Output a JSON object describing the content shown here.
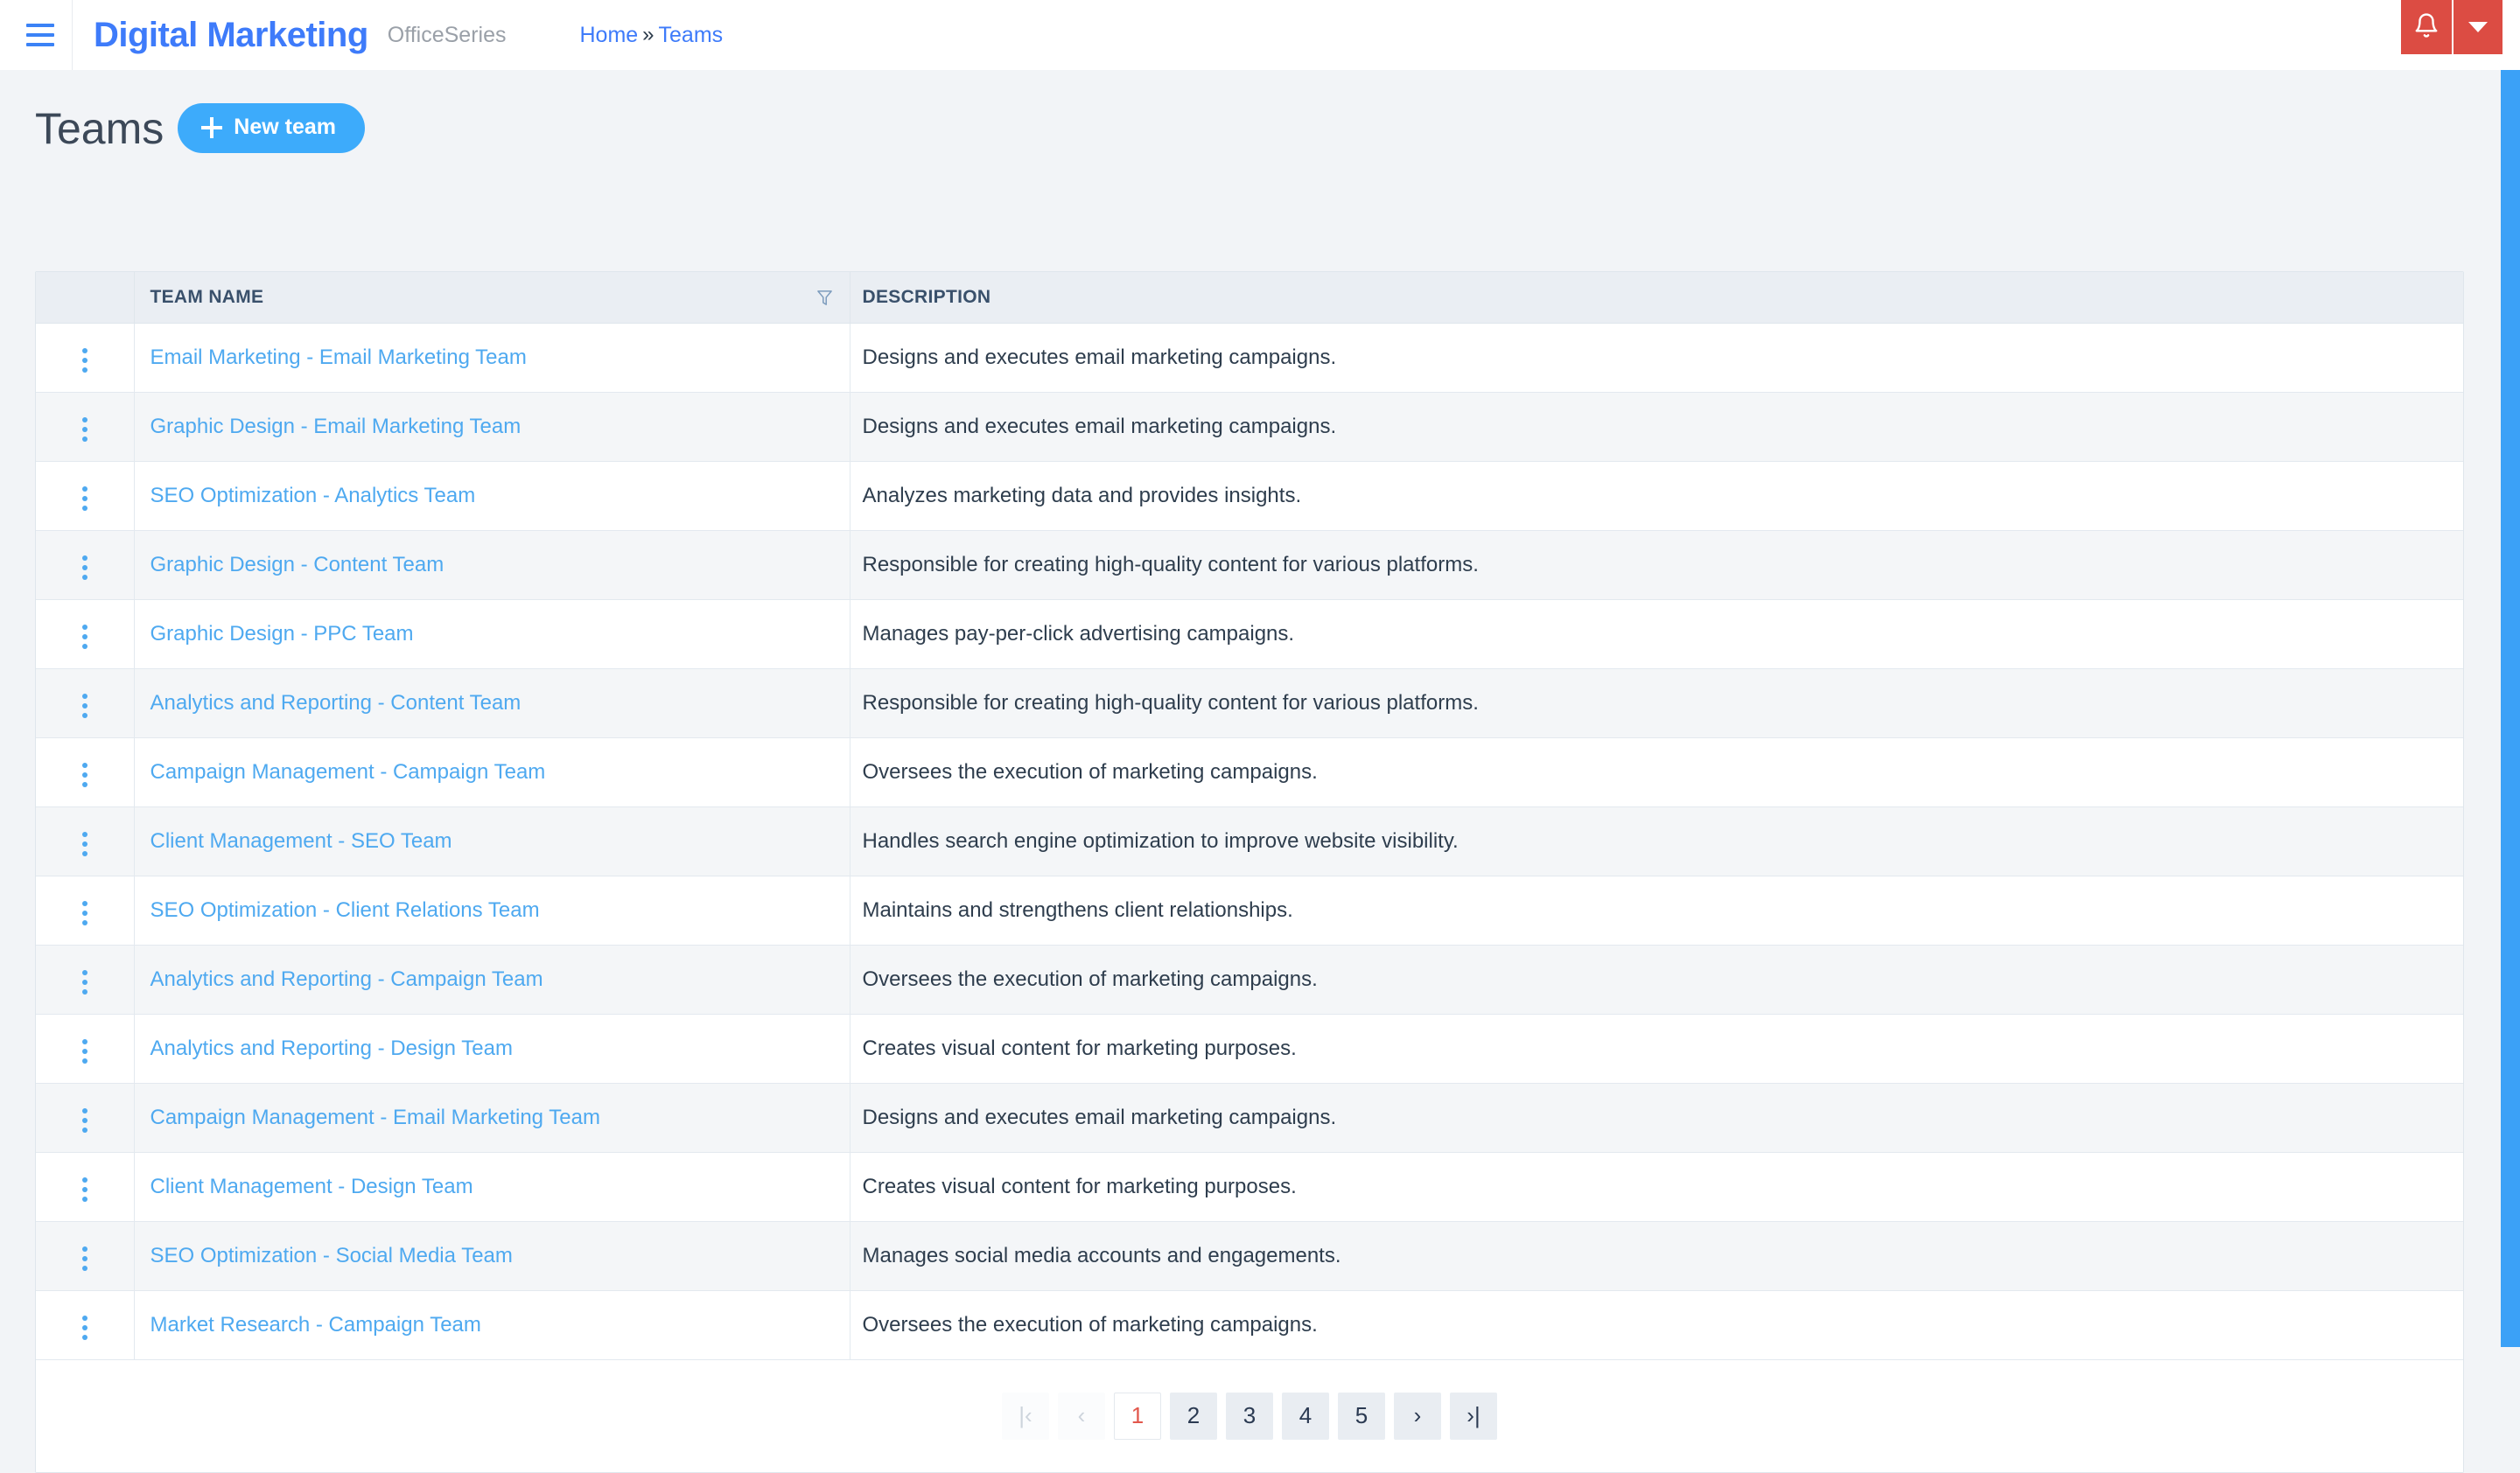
{
  "header": {
    "menu_icon": "hamburger-icon",
    "brand": "Digital Marketing",
    "brand_suffix": "OfficeSeries",
    "breadcrumb": {
      "home": "Home",
      "separator": "»",
      "current": "Teams"
    },
    "notification_icon": "bell-icon",
    "notification_dropdown_icon": "chevron-down-icon",
    "accent_red": "#dc4c43",
    "brand_blue": "#3e7bfa"
  },
  "page": {
    "title": "Teams",
    "new_button_label": "New team",
    "new_button_icon": "plus-icon",
    "new_button_color": "#3dabfb"
  },
  "table": {
    "columns": [
      "",
      "TEAM NAME",
      "DESCRIPTION"
    ],
    "filter_icon": "funnel-filter-icon",
    "row_menu_icon": "kebab-menu-icon",
    "rows": [
      {
        "name": "Email Marketing - Email Marketing Team",
        "description": "Designs and executes email marketing campaigns."
      },
      {
        "name": "Graphic Design - Email Marketing Team",
        "description": "Designs and executes email marketing campaigns."
      },
      {
        "name": "SEO Optimization - Analytics Team",
        "description": "Analyzes marketing data and provides insights."
      },
      {
        "name": "Graphic Design - Content Team",
        "description": "Responsible for creating high-quality content for various platforms."
      },
      {
        "name": "Graphic Design - PPC Team",
        "description": "Manages pay-per-click advertising campaigns."
      },
      {
        "name": "Analytics and Reporting - Content Team",
        "description": "Responsible for creating high-quality content for various platforms."
      },
      {
        "name": "Campaign Management - Campaign Team",
        "description": "Oversees the execution of marketing campaigns."
      },
      {
        "name": "Client Management - SEO Team",
        "description": "Handles search engine optimization to improve website visibility."
      },
      {
        "name": "SEO Optimization - Client Relations Team",
        "description": "Maintains and strengthens client relationships."
      },
      {
        "name": "Analytics and Reporting - Campaign Team",
        "description": "Oversees the execution of marketing campaigns."
      },
      {
        "name": "Analytics and Reporting - Design Team",
        "description": "Creates visual content for marketing purposes."
      },
      {
        "name": "Campaign Management - Email Marketing Team",
        "description": "Designs and executes email marketing campaigns."
      },
      {
        "name": "Client Management - Design Team",
        "description": "Creates visual content for marketing purposes."
      },
      {
        "name": "SEO Optimization - Social Media Team",
        "description": "Manages social media accounts and engagements."
      },
      {
        "name": "Market Research - Campaign Team",
        "description": "Oversees the execution of marketing campaigns."
      }
    ]
  },
  "pagination": {
    "first_label": "|‹",
    "prev_label": "‹",
    "pages": [
      "1",
      "2",
      "3",
      "4",
      "5"
    ],
    "active_page": "1",
    "next_label": "›",
    "last_label": "›|",
    "active_color": "#e2574c"
  }
}
